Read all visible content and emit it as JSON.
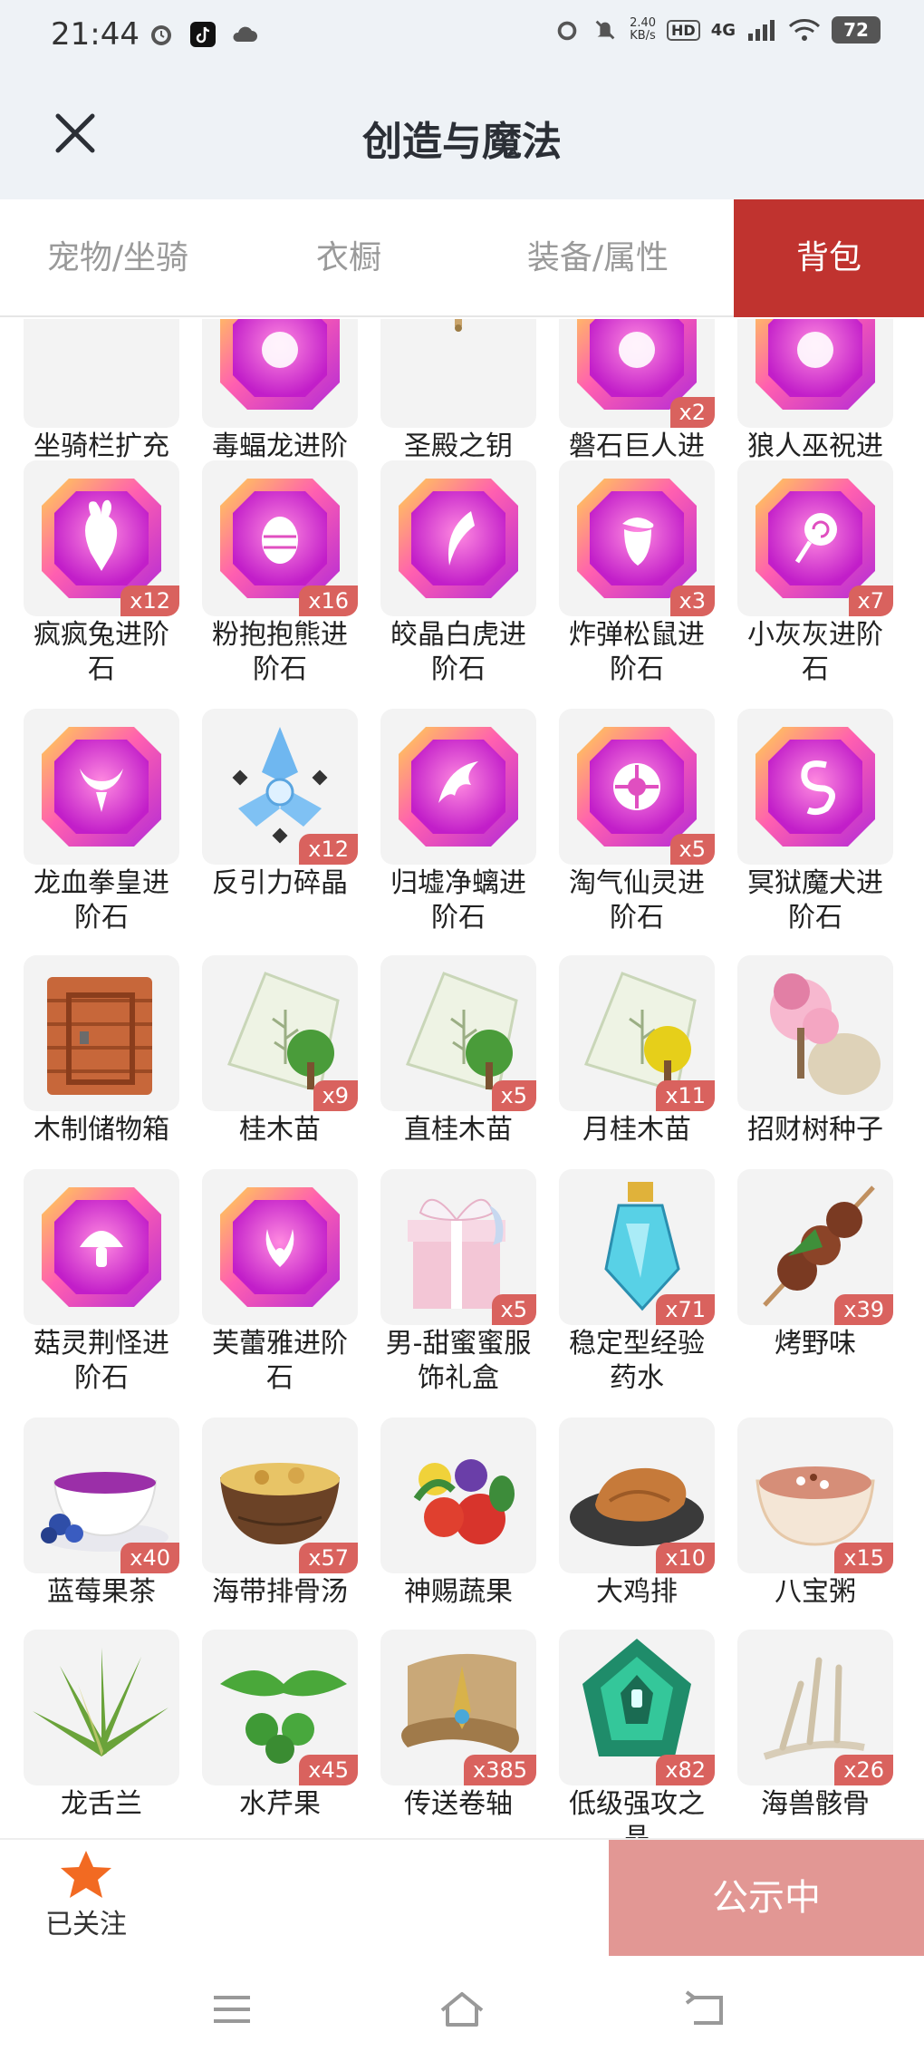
{
  "status": {
    "time": "21:44",
    "speed_top": "2.40",
    "speed_unit": "KB/s",
    "hd": "HD",
    "network": "4G",
    "battery": "72"
  },
  "header": {
    "title": "创造与魔法"
  },
  "tabs": [
    {
      "label": "宠物/坐骑",
      "active": false
    },
    {
      "label": "衣橱",
      "active": false
    },
    {
      "label": "装备/属性",
      "active": false
    },
    {
      "label": "背包",
      "active": true
    }
  ],
  "items": [
    {
      "name": "坐骑栏扩充卡",
      "count": "",
      "icon": "wand-icon"
    },
    {
      "name": "毒蝠龙进阶石",
      "count": "",
      "icon": "gem-icon"
    },
    {
      "name": "圣殿之钥",
      "count": "",
      "icon": "key-icon"
    },
    {
      "name": "磐石巨人进阶石",
      "count": "x2",
      "icon": "gem-icon"
    },
    {
      "name": "狼人巫祝进阶石",
      "count": "",
      "icon": "gem-icon"
    },
    {
      "name": "疯疯兔进阶石",
      "count": "x12",
      "icon": "gem-rabbit-icon"
    },
    {
      "name": "粉抱抱熊进阶石",
      "count": "x16",
      "icon": "gem-egg-icon"
    },
    {
      "name": "皎晶白虎进阶石",
      "count": "",
      "icon": "gem-claw-icon"
    },
    {
      "name": "炸弹松鼠进阶石",
      "count": "x3",
      "icon": "gem-acorn-icon"
    },
    {
      "name": "小灰灰进阶石",
      "count": "x7",
      "icon": "gem-lollipop-icon"
    },
    {
      "name": "龙血拳皇进阶石",
      "count": "",
      "icon": "gem-horns-icon"
    },
    {
      "name": "反引力碎晶",
      "count": "x12",
      "icon": "crystal-icon"
    },
    {
      "name": "归墟净螭进阶石",
      "count": "",
      "icon": "gem-wave-icon"
    },
    {
      "name": "淘气仙灵进阶石",
      "count": "x5",
      "icon": "gem-flower-icon"
    },
    {
      "name": "冥狱魔犬进阶石",
      "count": "",
      "icon": "gem-s-icon"
    },
    {
      "name": "木制储物箱",
      "count": "",
      "icon": "wooden-box-icon"
    },
    {
      "name": "桂木苗",
      "count": "x9",
      "icon": "seed-pack-icon"
    },
    {
      "name": "直桂木苗",
      "count": "x5",
      "icon": "seed-pack-icon"
    },
    {
      "name": "月桂木苗",
      "count": "x11",
      "icon": "seed-pack-yellow-icon"
    },
    {
      "name": "招财树种子",
      "count": "",
      "icon": "blossom-sack-icon"
    },
    {
      "name": "菇灵荆怪进阶石",
      "count": "",
      "icon": "gem-mushroom-icon"
    },
    {
      "name": "芙蕾雅进阶石",
      "count": "",
      "icon": "gem-wings-icon"
    },
    {
      "name": "男-甜蜜蜜服饰礼盒",
      "count": "x5",
      "icon": "gift-box-icon"
    },
    {
      "name": "稳定型经验药水",
      "count": "x71",
      "icon": "potion-icon"
    },
    {
      "name": "烤野味",
      "count": "x39",
      "icon": "skewer-icon"
    },
    {
      "name": "蓝莓果茶",
      "count": "x40",
      "icon": "tea-cup-icon"
    },
    {
      "name": "海带排骨汤",
      "count": "x57",
      "icon": "soup-bowl-icon"
    },
    {
      "name": "神赐蔬果",
      "count": "",
      "icon": "vegetables-icon"
    },
    {
      "name": "大鸡排",
      "count": "x10",
      "icon": "chicken-cutlet-icon"
    },
    {
      "name": "八宝粥",
      "count": "x15",
      "icon": "porridge-icon"
    },
    {
      "name": "龙舌兰",
      "count": "",
      "icon": "agave-icon"
    },
    {
      "name": "水芹果",
      "count": "x45",
      "icon": "cress-fruit-icon"
    },
    {
      "name": "传送卷轴",
      "count": "x385",
      "icon": "scroll-icon"
    },
    {
      "name": "低级强攻之晶",
      "count": "x82",
      "icon": "green-crystal-icon"
    },
    {
      "name": "海兽骸骨",
      "count": "x26",
      "icon": "bone-icon"
    }
  ],
  "bottom": {
    "follow_label": "已关注",
    "publish_label": "公示中"
  }
}
